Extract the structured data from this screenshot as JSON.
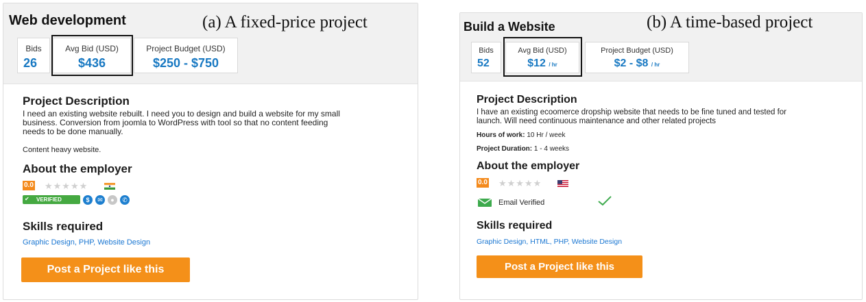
{
  "panel_a": {
    "title": "Web development",
    "caption": "(a) A fixed-price project",
    "stats": {
      "bids_label": "Bids",
      "bids_value": "26",
      "avg_label": "Avg Bid (USD)",
      "avg_value": "$436",
      "budget_label": "Project Budget (USD)",
      "budget_value": "$250 - $750"
    },
    "description_heading": "Project Description",
    "description_lines": [
      "I need an existing website rebuilt. I need you to design and build a website for my small",
      "business. Conversion from joomla to WordPress with tool so that no content feeding",
      "needs to be done manually."
    ],
    "description_extra": "Content heavy website.",
    "employer_heading": "About the employer",
    "rating": "0.0",
    "verified_badge": "VERIFIED",
    "skills_heading": "Skills required",
    "skills": "Graphic Design, PHP, Website Design",
    "cta_label": "Post a Project like this"
  },
  "panel_b": {
    "title": "Build a Website",
    "caption": "(b) A time-based project",
    "stats": {
      "bids_label": "Bids",
      "bids_value": "52",
      "avg_label": "Avg Bid (USD)",
      "avg_value": "$12",
      "avg_unit": "/ hr",
      "budget_label": "Project Budget (USD)",
      "budget_value": "$2 - $8",
      "budget_unit": "/ hr"
    },
    "description_heading": "Project Description",
    "description_lines": [
      "I have an existing ecoomerce dropship website that needs to be fine tuned and tested for",
      "launch. Will need continuous maintenance and other related projects"
    ],
    "hours_label": "Hours of work:",
    "hours_value": "10 Hr / week",
    "duration_label": "Project Duration:",
    "duration_value": "1 - 4 weeks",
    "employer_heading": "About the employer",
    "rating": "0.0",
    "email_verified": "Email Verified",
    "skills_heading": "Skills required",
    "skills": "Graphic Design, HTML, PHP, Website Design",
    "cta_label": "Post a Project like this"
  },
  "colors": {
    "accent_blue": "#1778c2",
    "cta_orange": "#f49019",
    "rating_orange": "#f48a1c",
    "verified_green": "#45a941"
  }
}
